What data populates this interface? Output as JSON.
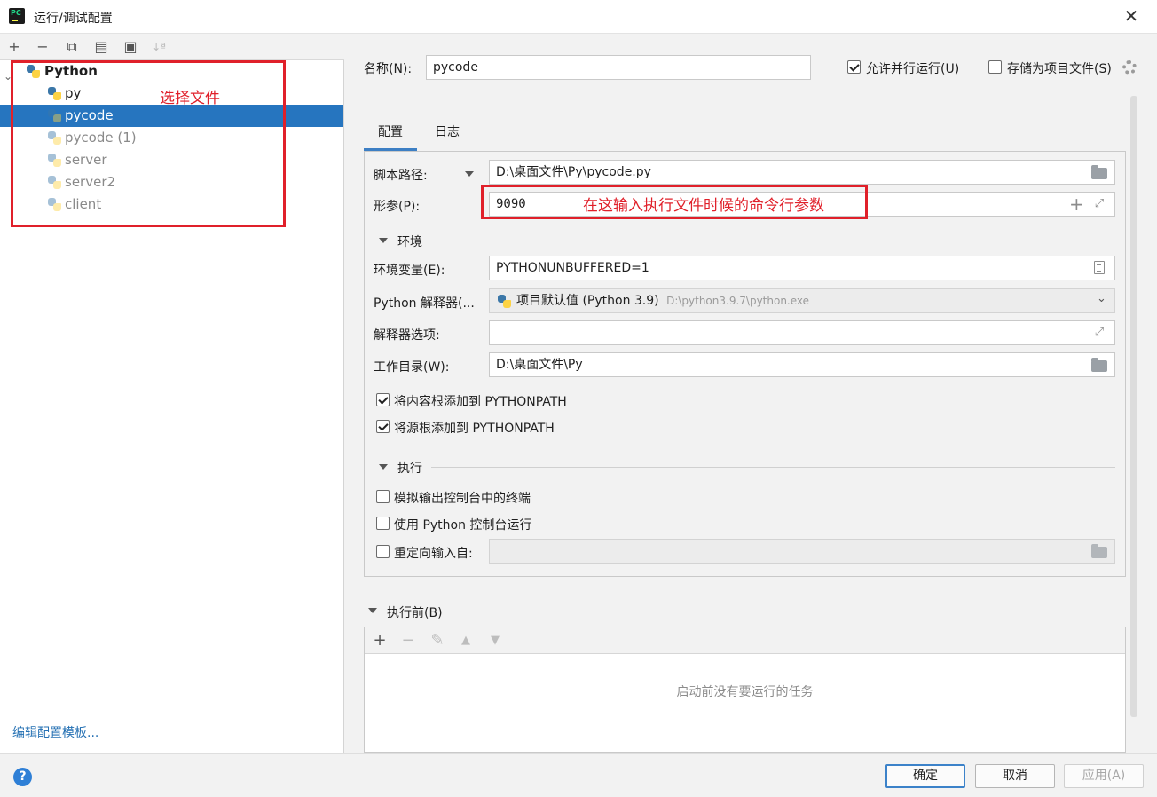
{
  "window": {
    "title": "运行/调试配置",
    "close_glyph": "✕"
  },
  "left": {
    "toolbar": {
      "add": "+",
      "remove": "−",
      "copy": "⧉",
      "save": "▤",
      "folder": "▣",
      "sort": "↓ª"
    },
    "tree": {
      "root": "Python",
      "items": [
        {
          "label": "py",
          "selected": false,
          "dim": false
        },
        {
          "label": "pycode",
          "selected": true,
          "dim": false
        },
        {
          "label": "pycode (1)",
          "selected": false,
          "dim": true
        },
        {
          "label": "server",
          "selected": false,
          "dim": true
        },
        {
          "label": "server2",
          "selected": false,
          "dim": true
        },
        {
          "label": "client",
          "selected": false,
          "dim": true
        }
      ]
    },
    "annotation": "选择文件",
    "edit_templates": "编辑配置模板..."
  },
  "right": {
    "name_label": "名称(N):",
    "name_value": "pycode",
    "allow_parallel": {
      "label": "允许并行运行(U)",
      "checked": true
    },
    "store_as_project": {
      "label": "存储为项目文件(S)",
      "checked": false
    },
    "tabs": [
      "配置",
      "日志"
    ],
    "script_path": {
      "label": "脚本路径:",
      "value": "D:\\桌面文件\\Py\\pycode.py"
    },
    "params": {
      "label": "形参(P):",
      "value": "9090"
    },
    "params_annotation": "在这输入执行文件时候的命令行参数",
    "env_section": "环境",
    "env_vars": {
      "label": "环境变量(E):",
      "value": "PYTHONUNBUFFERED=1"
    },
    "interpreter": {
      "label": "Python 解释器(...",
      "value": "项目默认值 (Python 3.9)",
      "path": "D:\\python3.9.7\\python.exe"
    },
    "interp_options": {
      "label": "解释器选项:",
      "value": ""
    },
    "workdir": {
      "label": "工作目录(W):",
      "value": "D:\\桌面文件\\Py"
    },
    "add_content_roots": {
      "label": "将内容根添加到 PYTHONPATH",
      "checked": true
    },
    "add_source_roots": {
      "label": "将源根添加到 PYTHONPATH",
      "checked": true
    },
    "exec_section": "执行",
    "emulate_terminal": {
      "label": "模拟输出控制台中的终端",
      "checked": false
    },
    "python_console": {
      "label": "使用 Python 控制台运行",
      "checked": false
    },
    "redirect_input": {
      "label": "重定向输入自:",
      "checked": false,
      "value": ""
    },
    "before_launch": {
      "label": "执行前(B)",
      "toolbar": {
        "add": "+",
        "remove": "−",
        "edit": "✎",
        "up": "▲",
        "down": "▼"
      },
      "empty": "启动前没有要运行的任务"
    }
  },
  "footer": {
    "help": "?",
    "ok": "确定",
    "cancel": "取消",
    "apply": "应用(A)"
  }
}
